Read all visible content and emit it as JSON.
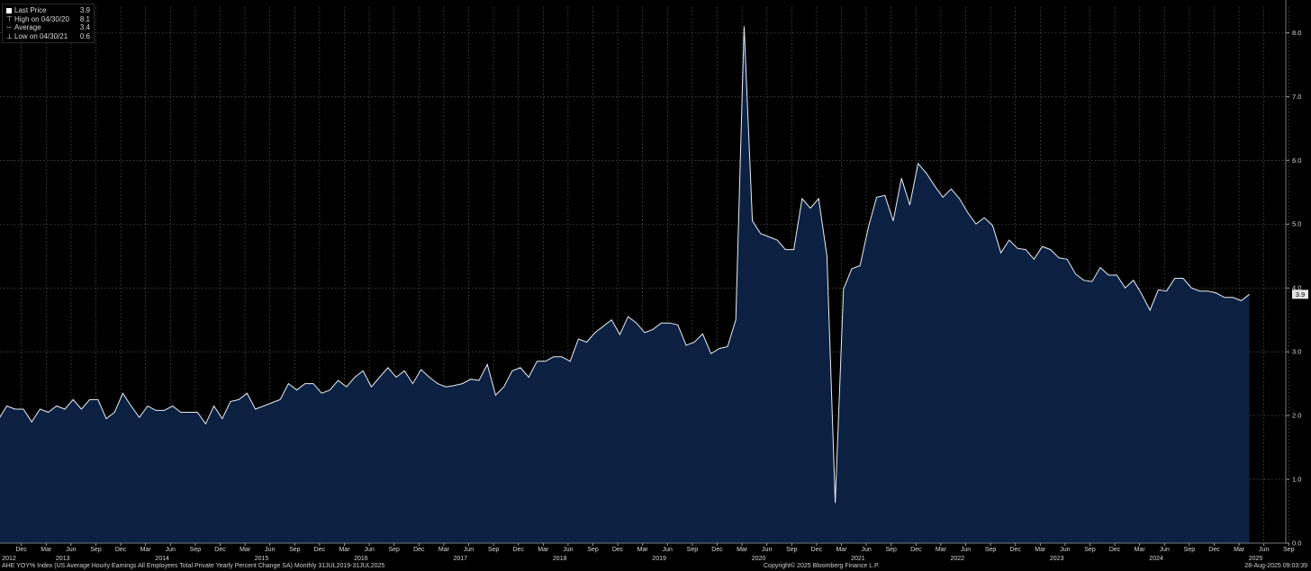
{
  "legend": {
    "items": [
      {
        "label": "Last Price",
        "value": "3.9",
        "marker": "box"
      },
      {
        "label": "High on 04/30/20",
        "value": "8.1",
        "marker": "⊤"
      },
      {
        "label": "Average",
        "value": "3.4",
        "marker": "┄"
      },
      {
        "label": "Low on 04/30/21",
        "value": "0.6",
        "marker": "⊥"
      }
    ]
  },
  "footer": {
    "description": "AHE YOY% Index (US Average Hourly Earnings All Employees Total Private Yearly Percent Change SA)  Monthly 31JUL2019-31JUL2025",
    "copyright": "Copyright© 2025 Bloomberg Finance L.P.",
    "timestamp": "28-Aug-2025 09:03:39"
  },
  "colors": {
    "background": "#000000",
    "area_fill": "#0c2141",
    "line": "#e8edf5",
    "grid": "#6a6a6a",
    "text": "#d8d8d8"
  },
  "chart_data": {
    "type": "area",
    "series": [
      {
        "name": "",
        "values": [
          1.97,
          1.65,
          1.94,
          2.15,
          2.1,
          2.1,
          1.9,
          2.1,
          2.05,
          2.15,
          2.1,
          2.25,
          2.1,
          2.25,
          2.25,
          1.95,
          2.05,
          2.35,
          2.15,
          1.97,
          2.15,
          2.08,
          2.08,
          2.15,
          2.05,
          2.05,
          2.05,
          1.87,
          2.15,
          1.95,
          2.22,
          2.25,
          2.35,
          2.1,
          2.15,
          2.2,
          2.25,
          2.5,
          2.4,
          2.5,
          2.5,
          2.35,
          2.4,
          2.55,
          2.45,
          2.6,
          2.7,
          2.45,
          2.6,
          2.75,
          2.6,
          2.7,
          2.5,
          2.72,
          2.6,
          2.5,
          2.45,
          2.47,
          2.5,
          2.57,
          2.55,
          2.8,
          2.32,
          2.45,
          2.7,
          2.75,
          2.6,
          2.85,
          2.85,
          2.92,
          2.92,
          2.85,
          3.2,
          3.15,
          3.3,
          3.4,
          3.5,
          3.27,
          3.55,
          3.45,
          3.3,
          3.35,
          3.45,
          3.45,
          3.42,
          3.1,
          3.15,
          3.28,
          2.97,
          3.05,
          3.08,
          3.5,
          8.1,
          5.05,
          4.85,
          4.8,
          4.75,
          4.6,
          4.6,
          5.4,
          5.25,
          5.4,
          4.5,
          0.63,
          3.98,
          4.3,
          4.35,
          4.95,
          5.42,
          5.45,
          5.05,
          5.72,
          5.3,
          5.95,
          5.8,
          5.6,
          5.42,
          5.55,
          5.4,
          5.18,
          5.0,
          5.1,
          4.98,
          4.55,
          4.75,
          4.62,
          4.6,
          4.45,
          4.65,
          4.6,
          4.47,
          4.45,
          4.22,
          4.12,
          4.1,
          4.32,
          4.2,
          4.2,
          4.0,
          4.12,
          3.9,
          3.65,
          3.97,
          3.95,
          4.15,
          4.15,
          4.0,
          3.95,
          3.95,
          3.92,
          3.85,
          3.85,
          3.8,
          3.9
        ]
      }
    ],
    "ylim": [
      0,
      8.4
    ],
    "yticks": [
      "0.0",
      "1.0",
      "2.0",
      "3.0",
      "4.0",
      "5.0",
      "6.0",
      "7.0",
      "8.0"
    ],
    "last_value_label": "3.9",
    "month_ticks": [
      "Dec",
      "Mar",
      "Jun",
      "Sep",
      "Dec",
      "Mar",
      "Jun",
      "Sep",
      "Dec",
      "Mar",
      "Jun",
      "Sep",
      "Dec",
      "Mar",
      "Jun",
      "Sep",
      "Dec",
      "Mar",
      "Jun",
      "Sep",
      "Dec",
      "Mar",
      "Jun",
      "Sep",
      "Dec",
      "Mar",
      "Jun",
      "Sep",
      "Dec",
      "Mar",
      "Jun",
      "Sep",
      "Dec",
      "Mar",
      "Jun",
      "Sep",
      "Dec",
      "Mar",
      "Jun",
      "Sep",
      "Dec",
      "Mar",
      "Jun",
      "Sep",
      "Dec",
      "Mar",
      "Jun",
      "Sep",
      "Dec",
      "Mar",
      "Jun",
      "Sep"
    ],
    "year_ticks": [
      {
        "label": "2012",
        "m": 0
      },
      {
        "label": "2013",
        "m": 5
      },
      {
        "label": "2014",
        "m": 17
      },
      {
        "label": "2015",
        "m": 29
      },
      {
        "label": "2016",
        "m": 41
      },
      {
        "label": "2017",
        "m": 53
      },
      {
        "label": "2018",
        "m": 65
      },
      {
        "label": "2019",
        "m": 77
      },
      {
        "label": "2020",
        "m": 89
      },
      {
        "label": "2021",
        "m": 101
      },
      {
        "label": "2022",
        "m": 113
      },
      {
        "label": "2023",
        "m": 125
      },
      {
        "label": "2024",
        "m": 137
      },
      {
        "label": "2025",
        "m": 149
      }
    ],
    "grid": true,
    "legend_position": "top-left"
  }
}
